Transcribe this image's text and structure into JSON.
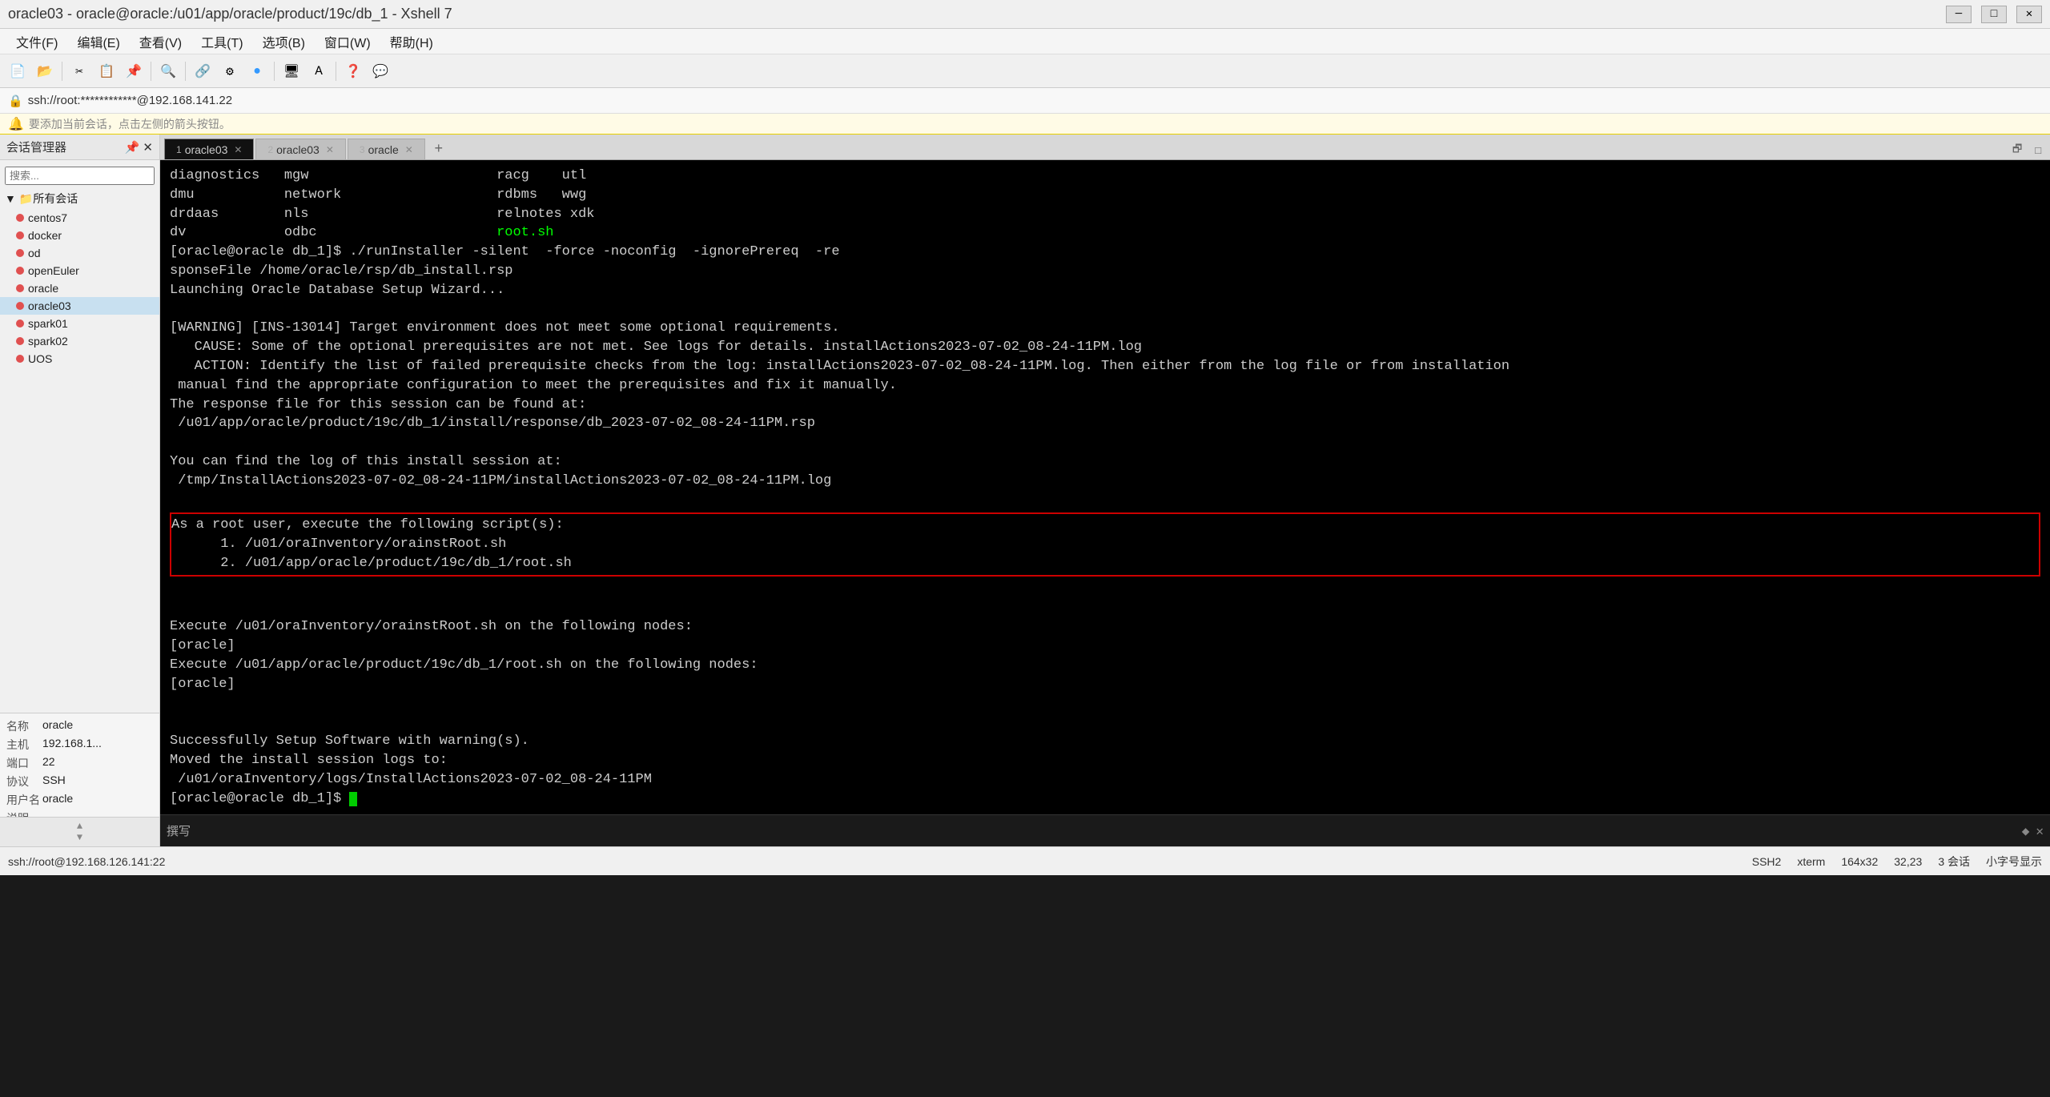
{
  "window": {
    "title": "oracle03 - oracle@oracle:/u01/app/oracle/product/19c/db_1 - Xshell 7",
    "minimize": "─",
    "maximize": "□",
    "close": "✕"
  },
  "menubar": {
    "items": [
      "文件(F)",
      "编辑(E)",
      "查看(V)",
      "工具(T)",
      "选项(B)",
      "窗口(W)",
      "帮助(H)"
    ]
  },
  "address_bar": {
    "text": "ssh://root:************@192.168.141.22"
  },
  "notice_bar": {
    "icon": "🔔",
    "text": "要添加当前会话，点击左侧的箭头按钮。"
  },
  "sidebar": {
    "header": "会话管理器",
    "pin_icon": "📌",
    "close_icon": "✕",
    "tree_root": "所有会话",
    "sessions": [
      {
        "name": "centos7",
        "active": false
      },
      {
        "name": "docker",
        "active": false
      },
      {
        "name": "od",
        "active": false
      },
      {
        "name": "openEuler",
        "active": false
      },
      {
        "name": "oracle",
        "active": false
      },
      {
        "name": "oracle03",
        "active": true
      },
      {
        "name": "spark01",
        "active": false
      },
      {
        "name": "spark02",
        "active": false
      },
      {
        "name": "UOS",
        "active": false
      }
    ]
  },
  "info_panel": {
    "name_label": "名称",
    "name_value": "oracle",
    "host_label": "主机",
    "host_value": "192.168.1...",
    "port_label": "端口",
    "port_value": "22",
    "protocol_label": "协议",
    "protocol_value": "SSH",
    "user_label": "用户名",
    "user_value": "oracle",
    "desc_label": "说明",
    "desc_value": ""
  },
  "tabs": [
    {
      "number": "1",
      "label": "oracle03",
      "active": true
    },
    {
      "number": "2",
      "label": "oracle03",
      "active": false
    },
    {
      "number": "3",
      "label": "oracle",
      "active": false
    }
  ],
  "terminal": {
    "lines": [
      "diagnostics   mgw                       racg    utl",
      "dmu           network                   rdbms   wwg",
      "drdaas        nls                       relnotes xdk",
      "dv            odbc                      root.sh",
      "[oracle@oracle db_1]$ ./runInstaller -silent  -force -noconfig  -ignorePrereq  -re",
      "sponseFile /home/oracle/rsp/db_install.rsp",
      "Launching Oracle Database Setup Wizard...",
      "",
      "[WARNING] [INS-13014] Target environment does not meet some optional requirements.",
      "   CAUSE: Some of the optional prerequisites are not met. See logs for details. installActions2023-07-02_08-24-11PM.log",
      "   ACTION: Identify the list of failed prerequisite checks from the log: installActions2023-07-02_08-24-11PM.log. Then either from the log file or from installation",
      " manual find the appropriate configuration to meet the prerequisites and fix it manually.",
      "The response file for this session can be found at:",
      " /u01/app/oracle/product/19c/db_1/install/response/db_2023-07-02_08-24-11PM.rsp",
      "",
      "You can find the log of this install session at:",
      " /tmp/InstallActions2023-07-02_08-24-11PM/installActions2023-07-02_08-24-11PM.log",
      ""
    ],
    "boxed_section": [
      "As a root user, execute the following script(s):",
      "      1. /u01/oraInventory/orainstRoot.sh",
      "      2. /u01/app/oracle/product/19c/db_1/root.sh"
    ],
    "after_box": [
      "",
      "Execute /u01/oraInventory/orainstRoot.sh on the following nodes:",
      "[oracle]",
      "Execute /u01/app/oracle/product/19c/db_1/root.sh on the following nodes:",
      "[oracle]",
      "",
      "",
      "Successfully Setup Software with warning(s).",
      "Moved the install session logs to:",
      " /u01/oraInventory/logs/InstallActions2023-07-02_08-24-11PM",
      "[oracle@oracle db_1]$ "
    ]
  },
  "compose_panel": {
    "label": "撰写",
    "resize_icon": "◆ ✕"
  },
  "status_bar": {
    "left": "ssh://root@192.168.126.141:22",
    "ssh2": "SSH2",
    "xterm": "xterm",
    "size": "164x32",
    "position": "32,23",
    "sessions_count": "3 会话",
    "right_text": "小字号显示"
  }
}
